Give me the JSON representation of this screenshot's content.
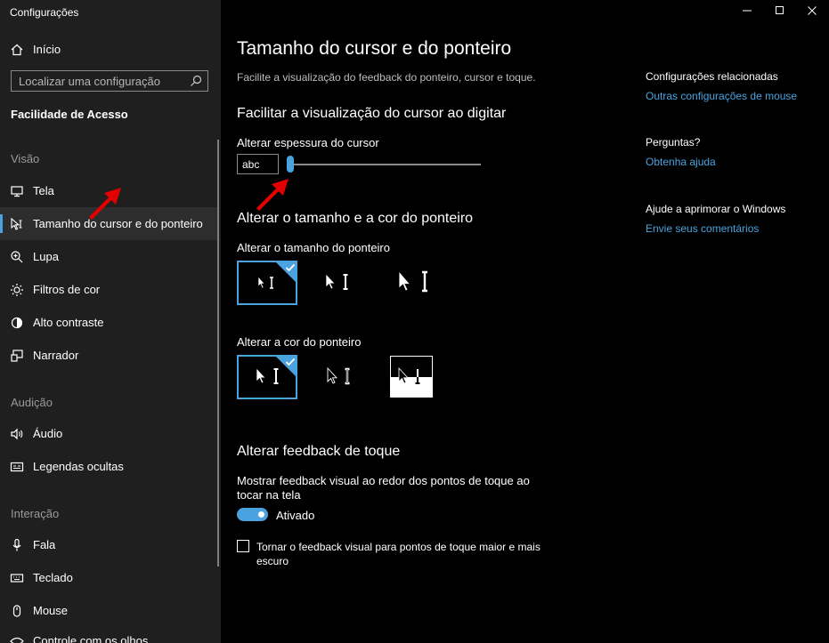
{
  "window": {
    "title": "Configurações"
  },
  "sidebar": {
    "home": "Início",
    "search_placeholder": "Localizar uma configuração",
    "section_title": "Facilidade de Acesso",
    "categories": {
      "vision": "Visão",
      "hearing": "Audição",
      "interaction": "Interação"
    },
    "items": {
      "display": "Tela",
      "cursor": "Tamanho do cursor e do ponteiro",
      "magnifier": "Lupa",
      "color_filters": "Filtros de cor",
      "high_contrast": "Alto contraste",
      "narrator": "Narrador",
      "audio": "Áudio",
      "captions": "Legendas ocultas",
      "speech": "Fala",
      "keyboard": "Teclado",
      "mouse": "Mouse",
      "partial": "Controle com os olhos"
    },
    "selected": "cursor"
  },
  "main": {
    "title": "Tamanho do cursor e do ponteiro",
    "subtitle": "Facilite a visualização do feedback do ponteiro, cursor e toque.",
    "cursor_section": {
      "heading": "Facilitar a visualização do cursor ao digitar",
      "thickness_label": "Alterar espessura do cursor",
      "preview_text": "abc",
      "thickness_value": 1
    },
    "pointer_section": {
      "heading": "Alterar o tamanho e a cor do ponteiro",
      "size_label": "Alterar o tamanho do ponteiro",
      "color_label": "Alterar a cor do ponteiro",
      "selected_size": 1,
      "selected_color": 1
    },
    "touch_section": {
      "heading": "Alterar feedback de toque",
      "show_label": "Mostrar feedback visual ao redor dos pontos de toque ao tocar na tela",
      "toggle_state": "Ativado",
      "bigger_label": "Tornar o feedback visual para pontos de toque maior e mais escuro"
    }
  },
  "related": {
    "heading": "Configurações relacionadas",
    "mouse_link": "Outras configurações de mouse",
    "questions_heading": "Perguntas?",
    "help_link": "Obtenha ajuda",
    "improve_heading": "Ajude a aprimorar o Windows",
    "feedback_link": "Envie seus comentários"
  },
  "colors": {
    "accent": "#4aa3df",
    "sidebar_bg": "#1f1f1f",
    "annotation_arrow": "#e30000"
  }
}
